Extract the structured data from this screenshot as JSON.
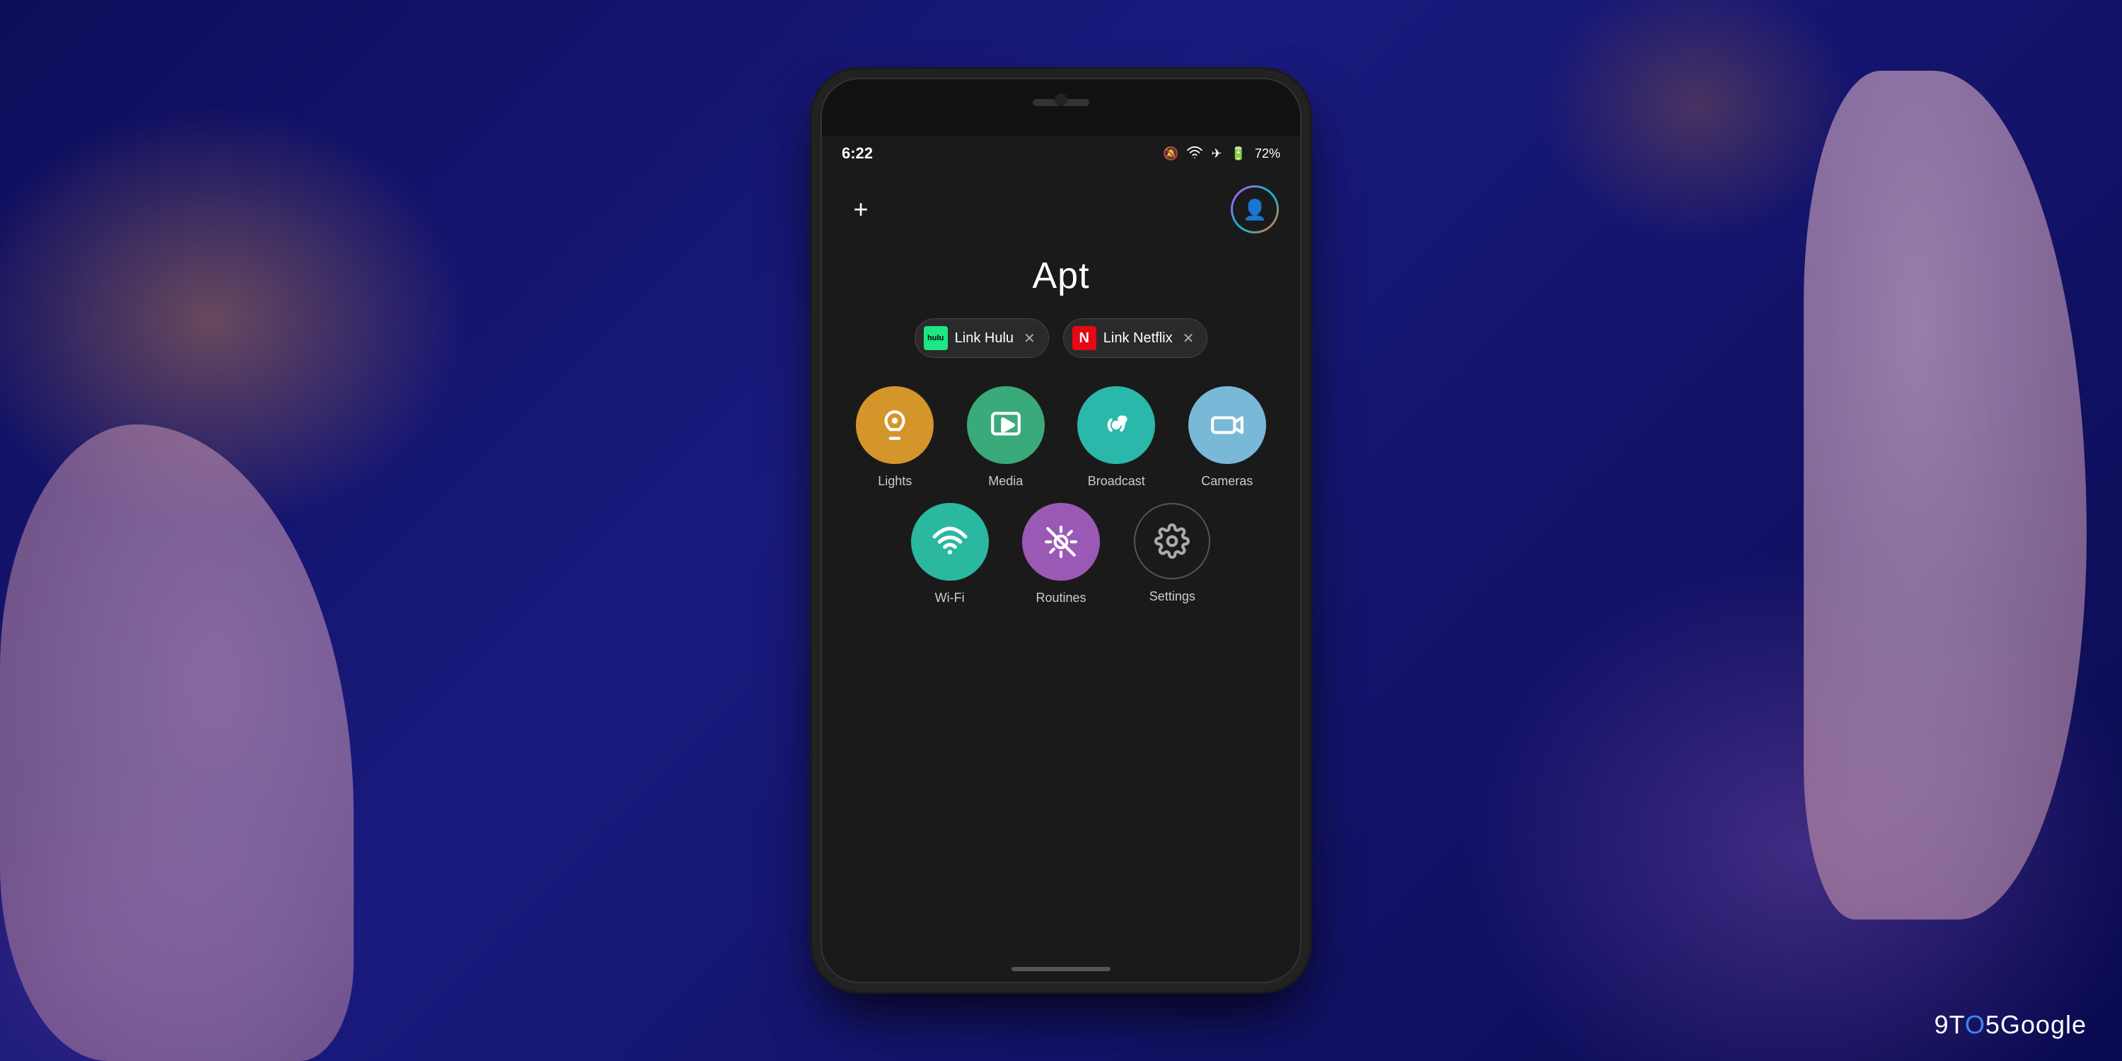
{
  "background": {
    "color": "#1a1a6e"
  },
  "watermark": {
    "text": "9TO5Google",
    "prefix": "9T",
    "middle": "O",
    "suffix": "5Google"
  },
  "phone": {
    "status_bar": {
      "time": "6:22",
      "battery": "72%",
      "icons": [
        "mute-icon",
        "wifi-icon",
        "airplane-icon",
        "battery-icon"
      ]
    },
    "app_title": "Apt",
    "add_button_label": "+",
    "chips": [
      {
        "id": "hulu",
        "label": "Link Hulu",
        "icon_text": "hulu",
        "icon_bg": "#1ce783",
        "icon_color": "#000"
      },
      {
        "id": "netflix",
        "label": "Link Netflix",
        "icon_text": "N",
        "icon_bg": "#e50914",
        "icon_color": "#fff"
      }
    ],
    "grid_row1": [
      {
        "id": "lights",
        "label": "Lights",
        "color": "#d4952a",
        "icon": "bulb"
      },
      {
        "id": "media",
        "label": "Media",
        "color": "#3aaa7a",
        "icon": "play"
      },
      {
        "id": "broadcast",
        "label": "Broadcast",
        "color": "#2ab8aa",
        "icon": "broadcast"
      },
      {
        "id": "cameras",
        "label": "Cameras",
        "color": "#7ab8d8",
        "icon": "camera"
      }
    ],
    "grid_row2": [
      {
        "id": "wifi",
        "label": "Wi-Fi",
        "color": "#2ab8a0",
        "icon": "wifi"
      },
      {
        "id": "routines",
        "label": "Routines",
        "color": "#9b59b6",
        "icon": "sun-off"
      },
      {
        "id": "settings",
        "label": "Settings",
        "color": "transparent",
        "icon": "gear",
        "bordered": true
      }
    ]
  }
}
